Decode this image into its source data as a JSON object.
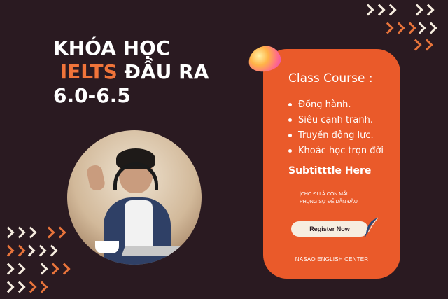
{
  "headline": {
    "line1": "KHÓA HỌC",
    "line2_accent": "IELTS",
    "line2_rest": " ĐẦU RA",
    "line3": "6.0-6.5"
  },
  "card": {
    "title": "Class Course :",
    "items": [
      {
        "label": "Đồng hành."
      },
      {
        "label": "Siêu cạnh tranh."
      },
      {
        "label": "Truyền động lực."
      },
      {
        "label": "Khoác học trọn đời"
      }
    ],
    "subtitle": "Subtitttle Here",
    "note_line1": "|CHO ĐI LÀ CÒN MÃI",
    "note_line2": "PHỤNG SỰ ĐỂ DẪN ĐẦU",
    "register_label": "Register Now",
    "footer": "NASAO ENGLISH CENTER"
  },
  "colors": {
    "background": "#2a1a21",
    "accent": "#ea5a2a",
    "cream": "#f6ede0"
  },
  "icons": [
    "chevron-pattern-icon",
    "gradient-blob-icon",
    "feather-quill-icon"
  ]
}
